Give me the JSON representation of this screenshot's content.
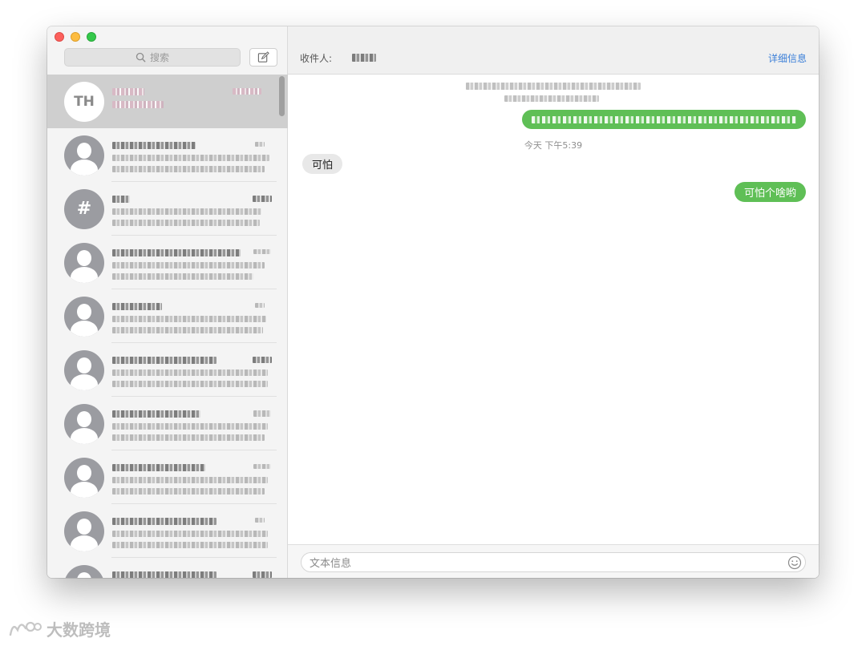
{
  "sidebar": {
    "search_placeholder": "搜索",
    "conversations": [
      {
        "avatar": "initials",
        "initials": "TH",
        "selected": true
      },
      {
        "avatar": "person"
      },
      {
        "avatar": "group",
        "group_glyph": "#"
      },
      {
        "avatar": "person"
      },
      {
        "avatar": "person"
      },
      {
        "avatar": "person"
      },
      {
        "avatar": "person"
      },
      {
        "avatar": "person"
      },
      {
        "avatar": "person"
      },
      {
        "avatar": "person"
      }
    ]
  },
  "header": {
    "to_label": "收件人:",
    "details_label": "详细信息"
  },
  "thread": {
    "timestamp": "今天 下午5:39",
    "received_message": "可怕",
    "sent_message": "可怕个啥哟"
  },
  "composer": {
    "placeholder": "文本信息"
  },
  "watermark": {
    "text": "大数跨境"
  },
  "colors": {
    "sent_bubble": "#5fbf56",
    "received_bubble": "#e8e8e8",
    "link": "#3b7fd8"
  }
}
